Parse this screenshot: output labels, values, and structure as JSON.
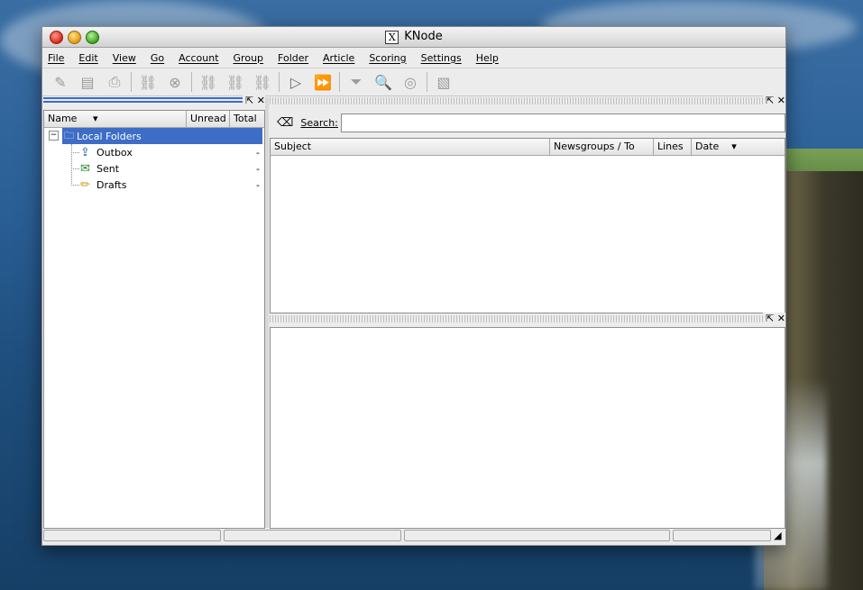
{
  "window": {
    "title": "KNode",
    "title_icon": "X"
  },
  "menu": [
    "File",
    "Edit",
    "View",
    "Go",
    "Account",
    "Group",
    "Folder",
    "Article",
    "Scoring",
    "Settings",
    "Help"
  ],
  "toolbar": {
    "icons": [
      "new-article-icon",
      "save-icon",
      "print-icon",
      "subscribe-icon",
      "cancel-icon",
      "fetch-icon",
      "fetch-all-icon",
      "post-icon",
      "next-unread-icon",
      "next-unread-group-icon",
      "filter-icon",
      "search-icon",
      "watch-icon",
      "view-source-icon"
    ]
  },
  "folder_pane": {
    "columns": [
      "Name",
      "Unread",
      "Total"
    ],
    "root": "Local Folders",
    "folders": [
      {
        "name": "Outbox",
        "total": "-"
      },
      {
        "name": "Sent",
        "total": "-"
      },
      {
        "name": "Drafts",
        "total": "-"
      }
    ]
  },
  "search": {
    "label": "Search:",
    "value": ""
  },
  "article_list": {
    "columns": [
      "Subject",
      "Newsgroups / To",
      "Lines",
      "Date"
    ]
  },
  "colors": {
    "selection": "#3d6dc6",
    "background_sea": "#2a5f96"
  }
}
